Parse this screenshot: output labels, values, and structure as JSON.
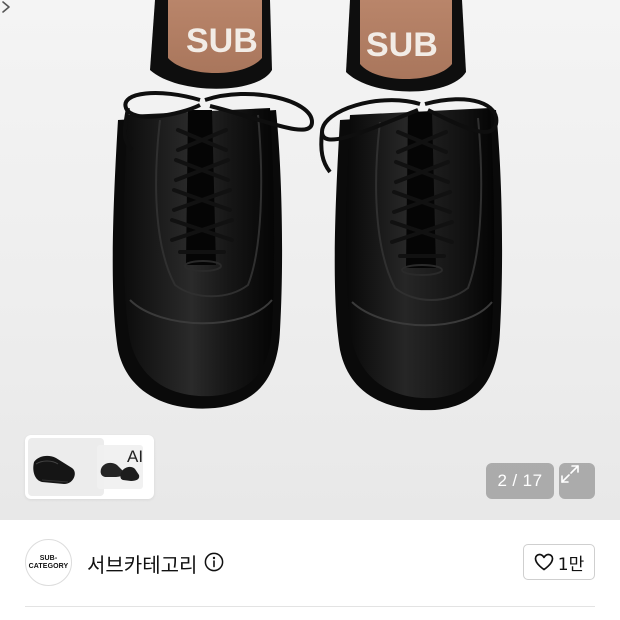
{
  "gallery": {
    "current_index": "2",
    "separator": "/",
    "total": "17",
    "ai_label": "AI",
    "insole_text": "SUB"
  },
  "brand": {
    "logo_line1": "SUB-",
    "logo_line2": "CATEGORY",
    "name": "서브카테고리"
  },
  "like": {
    "count": "1만"
  },
  "icons": {
    "info": "info-icon",
    "heart": "heart-outline-icon",
    "expand": "expand-icon",
    "chevron": "chevron-right-icon"
  }
}
